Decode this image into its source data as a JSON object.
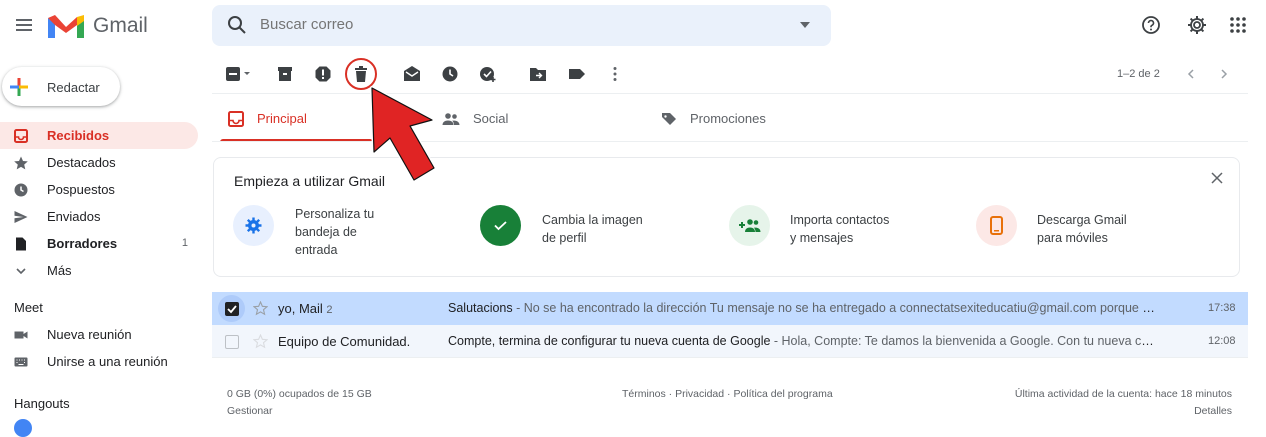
{
  "header": {
    "logo_text": "Gmail",
    "search_placeholder": "Buscar correo"
  },
  "compose": {
    "label": "Redactar"
  },
  "sidebar": {
    "items": [
      {
        "label": "Recibidos",
        "icon": "inbox-icon",
        "active": true
      },
      {
        "label": "Destacados",
        "icon": "star-icon"
      },
      {
        "label": "Pospuestos",
        "icon": "clock-icon"
      },
      {
        "label": "Enviados",
        "icon": "send-icon"
      },
      {
        "label": "Borradores",
        "icon": "draft-icon",
        "count": "1"
      },
      {
        "label": "Más",
        "icon": "chevron-down-icon"
      }
    ],
    "meet": {
      "title": "Meet",
      "items": [
        {
          "label": "Nueva reunión"
        },
        {
          "label": "Unirse a una reunión"
        }
      ]
    },
    "hangouts": {
      "title": "Hangouts"
    }
  },
  "toolbar": {
    "pagination": "1–2 de 2"
  },
  "tabs": [
    {
      "label": "Principal",
      "active": true
    },
    {
      "label": "Social"
    },
    {
      "label": "Promociones"
    }
  ],
  "onboarding": {
    "title": "Empieza a utilizar Gmail",
    "tasks": [
      {
        "line1": "Personaliza tu",
        "line2": "bandeja de",
        "line3": "entrada"
      },
      {
        "line1": "Cambia la imagen",
        "line2": "de perfil"
      },
      {
        "line1": "Importa contactos",
        "line2": "y mensajes"
      },
      {
        "line1": "Descarga Gmail",
        "line2": "para móviles"
      }
    ]
  },
  "emails": [
    {
      "sender": "yo, Mail",
      "thread_count": "2",
      "subject": "Salutacions",
      "snippet": " - No se ha encontrado la dirección Tu mensaje no se ha entregado a connectatsexiteducatiu@gmail.com porque n...",
      "time": "17:38",
      "selected": true
    },
    {
      "sender": "Equipo de Comunidad.",
      "subject": "Compte, termina de configurar tu nueva cuenta de Google",
      "snippet": " - Hola, Compte: Te damos la bienvenida a Google. Con tu nueva cuen...",
      "time": "12:08",
      "selected": false
    }
  ],
  "footer": {
    "storage": "0 GB (0%) ocupados de 15 GB",
    "manage": "Gestionar",
    "links": "Términos · Privacidad · Política del programa",
    "activity": "Última actividad de la cuenta: hace 18 minutos",
    "details": "Detalles"
  },
  "colors": {
    "accent": "#d93025",
    "selected_row": "#c2dbff"
  }
}
